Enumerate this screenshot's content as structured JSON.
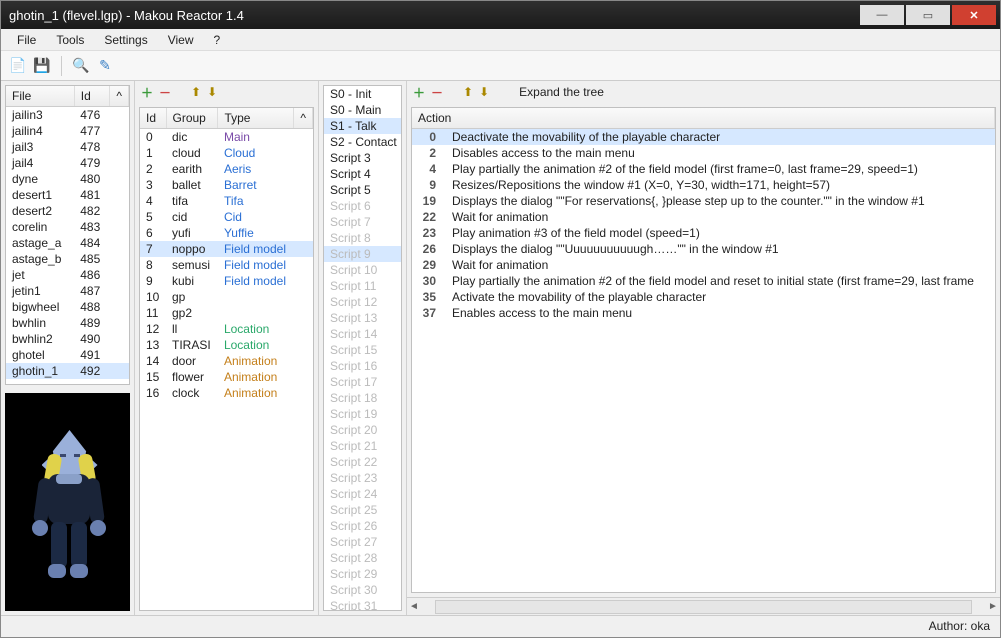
{
  "window": {
    "title": "ghotin_1 (flevel.lgp) - Makou Reactor 1.4"
  },
  "menu": [
    "File",
    "Tools",
    "Settings",
    "View",
    "?"
  ],
  "toolbar": [
    {
      "name": "new-icon"
    },
    {
      "name": "save-icon"
    },
    {
      "name": "sep"
    },
    {
      "name": "search-icon"
    },
    {
      "name": "script-icon"
    }
  ],
  "files": {
    "headers": [
      "File",
      "Id"
    ],
    "rows": [
      [
        "jailin3",
        "476"
      ],
      [
        "jailin4",
        "477"
      ],
      [
        "jail3",
        "478"
      ],
      [
        "jail4",
        "479"
      ],
      [
        "dyne",
        "480"
      ],
      [
        "desert1",
        "481"
      ],
      [
        "desert2",
        "482"
      ],
      [
        "corelin",
        "483"
      ],
      [
        "astage_a",
        "484"
      ],
      [
        "astage_b",
        "485"
      ],
      [
        "jet",
        "486"
      ],
      [
        "jetin1",
        "487"
      ],
      [
        "bigwheel",
        "488"
      ],
      [
        "bwhlin",
        "489"
      ],
      [
        "bwhlin2",
        "490"
      ],
      [
        "ghotel",
        "491"
      ],
      [
        "ghotin_1",
        "492"
      ]
    ],
    "selectedIdx": 16
  },
  "groups": {
    "headers": [
      "Id",
      "Group",
      "Type"
    ],
    "rows": [
      {
        "id": "0",
        "group": "dic",
        "type": "Main",
        "color": "#7a4aa8"
      },
      {
        "id": "1",
        "group": "cloud",
        "type": "Cloud",
        "color": "#2a6fd4"
      },
      {
        "id": "2",
        "group": "earith",
        "type": "Aeris",
        "color": "#2a6fd4"
      },
      {
        "id": "3",
        "group": "ballet",
        "type": "Barret",
        "color": "#2a6fd4"
      },
      {
        "id": "4",
        "group": "tifa",
        "type": "Tifa",
        "color": "#2a6fd4"
      },
      {
        "id": "5",
        "group": "cid",
        "type": "Cid",
        "color": "#2a6fd4"
      },
      {
        "id": "6",
        "group": "yufi",
        "type": "Yuffie",
        "color": "#2a6fd4"
      },
      {
        "id": "7",
        "group": "noppo",
        "type": "Field model",
        "color": "#2a6fd4"
      },
      {
        "id": "8",
        "group": "semusi",
        "type": "Field model",
        "color": "#2a6fd4"
      },
      {
        "id": "9",
        "group": "kubi",
        "type": "Field model",
        "color": "#2a6fd4"
      },
      {
        "id": "10",
        "group": "gp",
        "type": "",
        "color": ""
      },
      {
        "id": "11",
        "group": "gp2",
        "type": "",
        "color": ""
      },
      {
        "id": "12",
        "group": "ll",
        "type": "Location",
        "color": "#2aa86a"
      },
      {
        "id": "13",
        "group": "TIRASI",
        "type": "Location",
        "color": "#2aa86a"
      },
      {
        "id": "14",
        "group": "door",
        "type": "Animation",
        "color": "#c47f1a"
      },
      {
        "id": "15",
        "group": "flower",
        "type": "Animation",
        "color": "#c47f1a"
      },
      {
        "id": "16",
        "group": "clock",
        "type": "Animation",
        "color": "#c47f1a"
      }
    ],
    "selectedIdx": 7
  },
  "scripts": {
    "items": [
      {
        "t": "S0 - Init",
        "en": true
      },
      {
        "t": "S0 - Main",
        "en": true
      },
      {
        "t": "S1 - Talk",
        "en": true
      },
      {
        "t": "S2 - Contact",
        "en": true
      },
      {
        "t": "Script 3",
        "en": true
      },
      {
        "t": "Script 4",
        "en": true
      },
      {
        "t": "Script 5",
        "en": true
      },
      {
        "t": "Script 6",
        "en": false
      },
      {
        "t": "Script 7",
        "en": false
      },
      {
        "t": "Script 8",
        "en": false
      },
      {
        "t": "Script 9",
        "en": false
      },
      {
        "t": "Script 10",
        "en": false
      },
      {
        "t": "Script 11",
        "en": false
      },
      {
        "t": "Script 12",
        "en": false
      },
      {
        "t": "Script 13",
        "en": false
      },
      {
        "t": "Script 14",
        "en": false
      },
      {
        "t": "Script 15",
        "en": false
      },
      {
        "t": "Script 16",
        "en": false
      },
      {
        "t": "Script 17",
        "en": false
      },
      {
        "t": "Script 18",
        "en": false
      },
      {
        "t": "Script 19",
        "en": false
      },
      {
        "t": "Script 20",
        "en": false
      },
      {
        "t": "Script 21",
        "en": false
      },
      {
        "t": "Script 22",
        "en": false
      },
      {
        "t": "Script 23",
        "en": false
      },
      {
        "t": "Script 24",
        "en": false
      },
      {
        "t": "Script 25",
        "en": false
      },
      {
        "t": "Script 26",
        "en": false
      },
      {
        "t": "Script 27",
        "en": false
      },
      {
        "t": "Script 28",
        "en": false
      },
      {
        "t": "Script 29",
        "en": false
      },
      {
        "t": "Script 30",
        "en": false
      },
      {
        "t": "Script 31",
        "en": false
      }
    ],
    "selectedIdx": 2,
    "highlightedDisabledIdx": 10
  },
  "actionToolbar": {
    "expand": "Expand the tree"
  },
  "actions": {
    "header": "Action",
    "rows": [
      {
        "n": "0",
        "t": "Deactivate the movability of the playable character",
        "sel": true
      },
      {
        "n": "2",
        "t": "Disables access to the main menu"
      },
      {
        "n": "4",
        "t": "Play partially the animation #2 of the field model (first frame=0, last frame=29, speed=1)"
      },
      {
        "n": "9",
        "t": "Resizes/Repositions the window #1 (X=0, Y=30, width=171, height=57)"
      },
      {
        "n": "19",
        "t": "Displays the dialog \"\"For reservations{, }please step up to the counter.\"\" in the window #1"
      },
      {
        "n": "22",
        "t": "Wait for animation"
      },
      {
        "n": "23",
        "t": "Play animation #3 of the field model (speed=1)"
      },
      {
        "n": "26",
        "t": "Displays the dialog \"\"Uuuuuuuuuuugh……\"\" in the window #1"
      },
      {
        "n": "29",
        "t": "Wait for animation"
      },
      {
        "n": "30",
        "t": "Play partially the animation #2 of the field model and reset to initial state (first frame=29, last frame"
      },
      {
        "n": "35",
        "t": "Activate the movability of the playable character"
      },
      {
        "n": "37",
        "t": "Enables access to the main menu"
      }
    ]
  },
  "footer": {
    "author": "Author: oka"
  }
}
